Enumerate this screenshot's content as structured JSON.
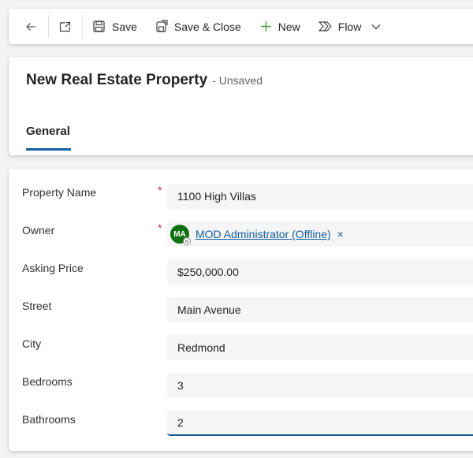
{
  "toolbar": {
    "save_label": "Save",
    "save_close_label": "Save & Close",
    "new_label": "New",
    "flow_label": "Flow"
  },
  "header": {
    "title": "New Real Estate Property",
    "status": "- Unsaved",
    "tabs": [
      {
        "label": "General",
        "selected": true
      }
    ]
  },
  "form": {
    "fields": [
      {
        "label": "Property Name",
        "required": "*",
        "value": "1100 High Villas"
      },
      {
        "label": "Owner",
        "required": "*",
        "avatar_initials": "MA",
        "value": "MOD Administrator (Offline)",
        "remove": "×"
      },
      {
        "label": "Asking Price",
        "value": "$250,000.00"
      },
      {
        "label": "Street",
        "value": "Main Avenue"
      },
      {
        "label": "City",
        "value": "Redmond"
      },
      {
        "label": "Bedrooms",
        "value": "3"
      },
      {
        "label": "Bathrooms",
        "value": "2"
      }
    ]
  },
  "colors": {
    "accent": "#115ea3",
    "required": "#c4314b",
    "avatar": "#0e700e",
    "field_bg": "#f5f5f5"
  }
}
